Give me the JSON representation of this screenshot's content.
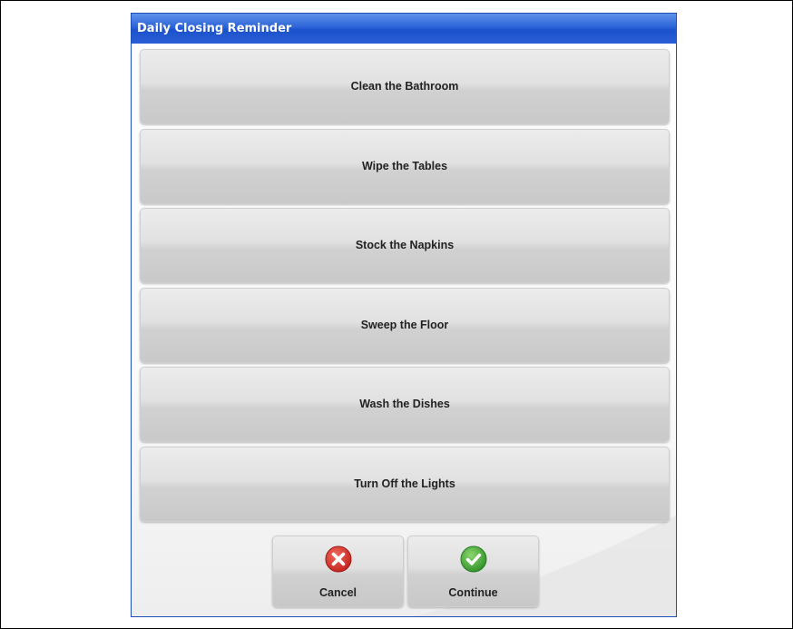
{
  "dialog": {
    "title": "Daily Closing Reminder",
    "tasks": [
      {
        "label": "Clean the Bathroom"
      },
      {
        "label": "Wipe the Tables"
      },
      {
        "label": "Stock the Napkins"
      },
      {
        "label": "Sweep the Floor"
      },
      {
        "label": "Wash the Dishes"
      },
      {
        "label": "Turn Off the Lights"
      }
    ],
    "actions": {
      "cancel_label": "Cancel",
      "continue_label": "Continue"
    }
  },
  "colors": {
    "titlebar": "#2c63d8",
    "cancel_icon": "#d9302c",
    "continue_icon": "#46a83a"
  },
  "icons": {
    "cancel": "x-circle-icon",
    "continue": "check-circle-icon"
  }
}
